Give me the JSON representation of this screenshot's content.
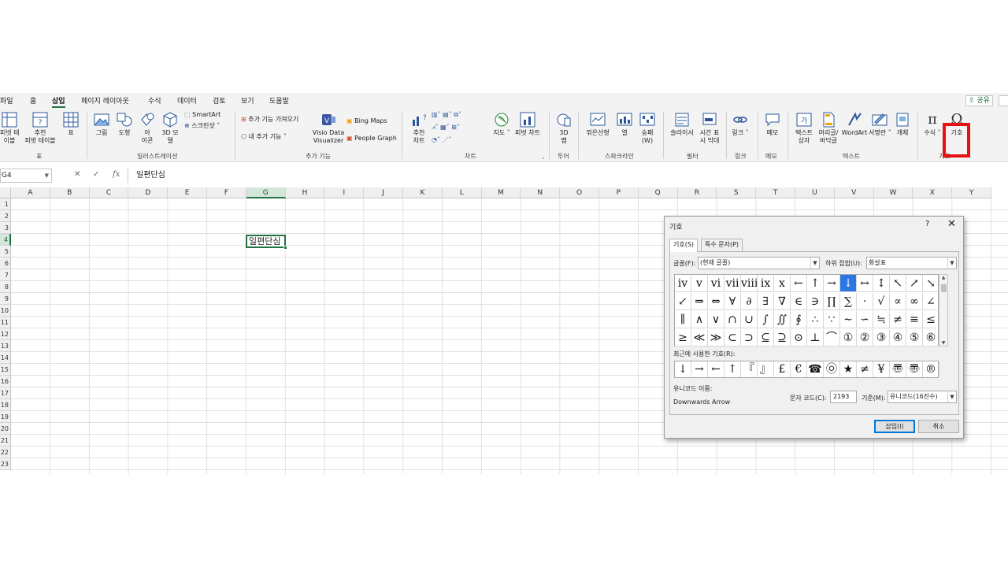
{
  "ribbon_tabs": [
    "파일",
    "홈",
    "삽입",
    "페이지 레이아웃",
    "수식",
    "데이터",
    "검토",
    "보기",
    "도움말"
  ],
  "share_label": "공유",
  "ribbon": {
    "pivot_table": "피벗 테\n이블",
    "recommended_pivot": "추천\n피벗 테이블",
    "table": "표",
    "group_tables": "표",
    "picture": "그림",
    "shapes": "도형",
    "icons": "아\n이콘",
    "models_3d": "3D 모\n델",
    "smartart": "SmartArt",
    "screenshot": "스크린샷",
    "group_illustrations": "일러스트레이션",
    "get_addins": "추가 기능 가져오기",
    "my_addins": "내 추가 기능",
    "visio": "Visio Data\nVisualizer",
    "bing_maps": "Bing Maps",
    "people_graph": "People Graph",
    "group_addins": "추가 기능",
    "recommended_charts": "추천\n차트",
    "maps": "지도",
    "pivot_chart": "피벗 차트",
    "group_charts": "차트",
    "map_3d": "3D\n맵",
    "group_tours": "투어",
    "line": "꺾은선형",
    "column": "열",
    "winloss": "승패\n(W)",
    "group_sparklines": "스파크라인",
    "slicer": "슬라이서",
    "timeline": "시간 표\n시 막대",
    "group_filters": "필터",
    "link": "링크",
    "group_links": "링크",
    "comment": "메모",
    "group_comments": "메모",
    "textbox": "텍스트\n상자",
    "header_footer": "머리글/\n바닥글",
    "wordart": "WordArt",
    "signature": "서명란",
    "object": "개체",
    "group_text": "텍스트",
    "equation": "수식",
    "symbol": "기호",
    "group_symbols": "기호"
  },
  "formula_bar": {
    "name_box": "G4",
    "formula": "일편단심"
  },
  "columns": [
    "A",
    "B",
    "C",
    "D",
    "E",
    "F",
    "G",
    "H",
    "I",
    "J",
    "K",
    "L",
    "M",
    "N",
    "O",
    "P",
    "Q",
    "R",
    "S",
    "T",
    "U",
    "V",
    "W",
    "X",
    "Y"
  ],
  "rows": [
    "1",
    "2",
    "3",
    "4",
    "5",
    "6",
    "7",
    "8",
    "9",
    "10",
    "11",
    "12",
    "13",
    "14",
    "15",
    "16",
    "17",
    "18",
    "19",
    "20",
    "21",
    "22",
    "23"
  ],
  "active_cell": {
    "ref": "G4",
    "value": "일편단심"
  },
  "dialog": {
    "title": "기호",
    "help": "?",
    "close": "✕",
    "tab_symbols": "기호(S)",
    "tab_special": "특수 문자(P)",
    "font_label": "글꼴(F):",
    "font_value": "(현재 글꼴)",
    "subset_label": "하위 집합(U):",
    "subset_value": "화살표",
    "symbol_rows": [
      [
        "ⅳ",
        "ⅴ",
        "ⅵ",
        "ⅶ",
        "ⅷ",
        "ⅸ",
        "ⅹ",
        "←",
        "↑",
        "→",
        "↓",
        "↔",
        "↕",
        "↖",
        "↗",
        "↘"
      ],
      [
        "↙",
        "⇒",
        "⇔",
        "∀",
        "∂",
        "∃",
        "∇",
        "∈",
        "∋",
        "∏",
        "∑",
        "·",
        "√",
        "∝",
        "∞",
        "∠"
      ],
      [
        "∥",
        "∧",
        "∨",
        "∩",
        "∪",
        "∫",
        "∬",
        "∮",
        "∴",
        "∵",
        "∼",
        "∽",
        "≒",
        "≠",
        "≡",
        "≤"
      ],
      [
        "≥",
        "≪",
        "≫",
        "⊂",
        "⊃",
        "⊆",
        "⊇",
        "⊙",
        "⊥",
        "⌒",
        "①",
        "②",
        "③",
        "④",
        "⑤",
        "⑥"
      ]
    ],
    "selected_symbol": "↓",
    "recent_label": "최근에 사용한 기호(R):",
    "recent_symbols": [
      "↓",
      "→",
      "←",
      "↑",
      "『",
      "』",
      "£",
      "€",
      "☎",
      "㉧",
      "★",
      "≠",
      "¥",
      "〠",
      "〠",
      "®"
    ],
    "unicode_name_label": "유니코드 이름:",
    "unicode_name": "Downwards Arrow",
    "char_code_label": "문자 코드(C):",
    "char_code": "2193",
    "from_label": "기준(M):",
    "from_value": "유니코드(16진수)",
    "insert_button": "삽입(I)",
    "cancel_button": "취소"
  }
}
